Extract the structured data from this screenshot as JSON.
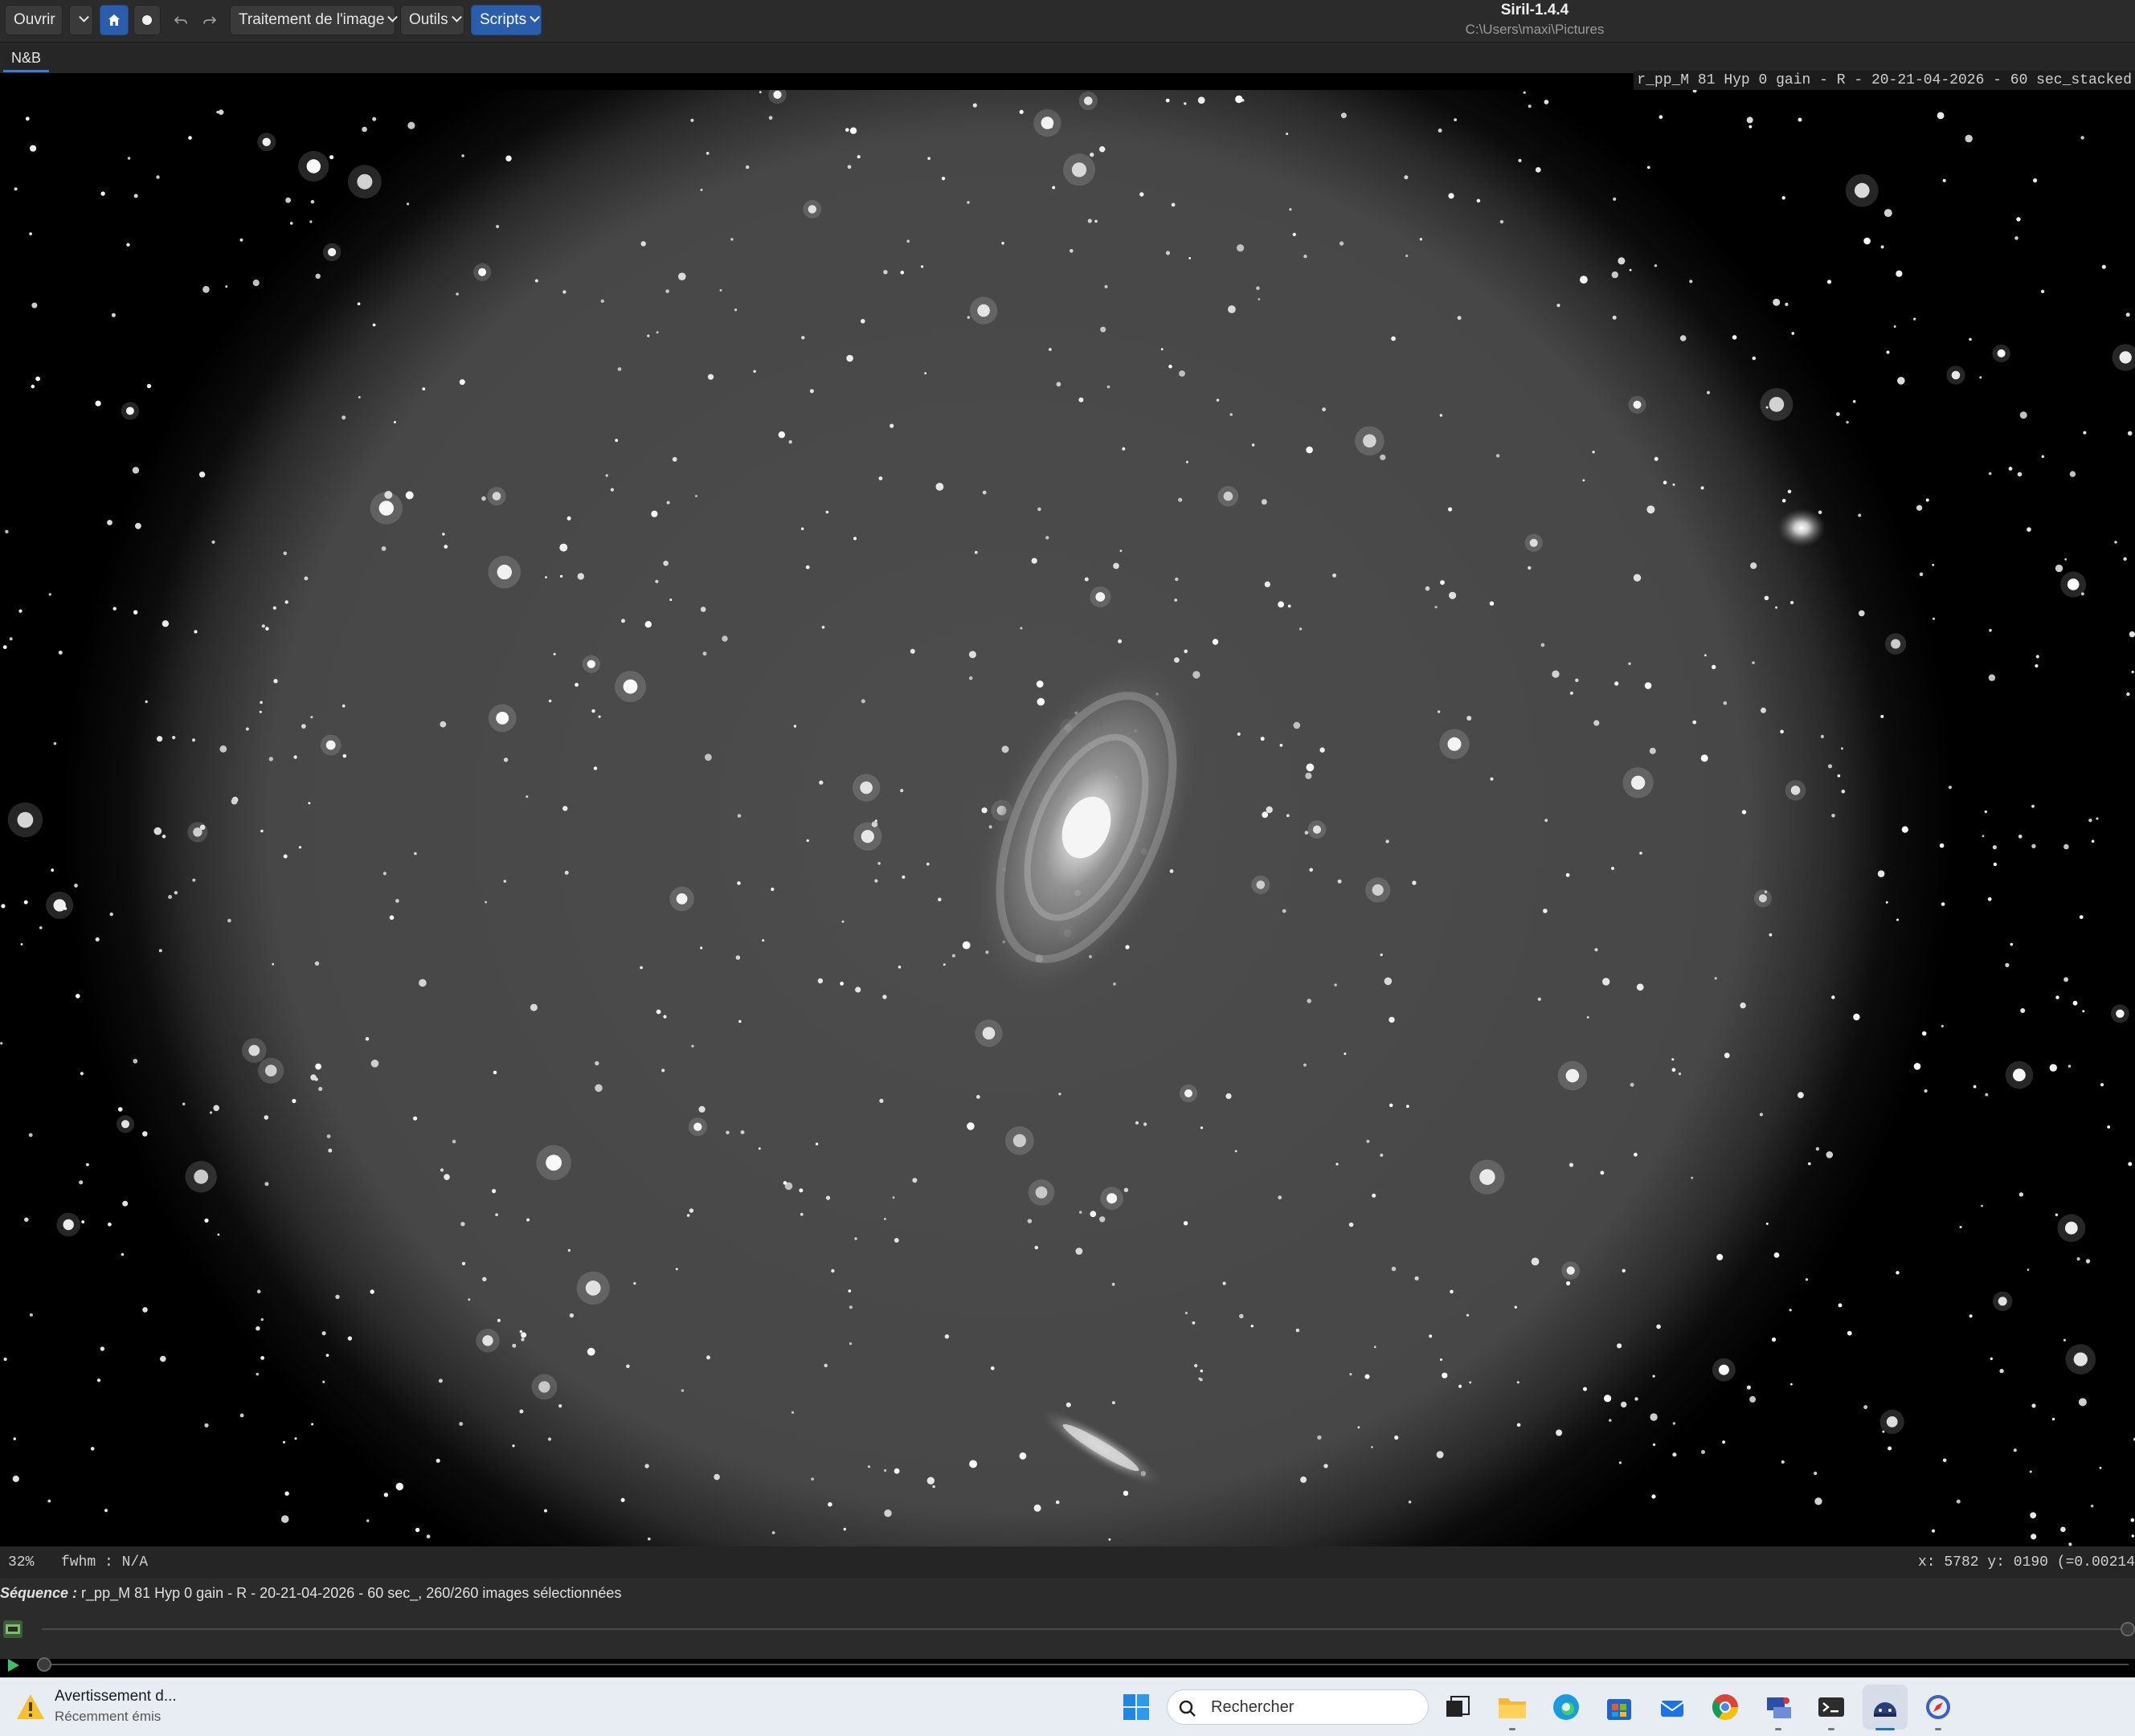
{
  "toolbar": {
    "open_label": "Ouvrir",
    "image_processing_label": "Traitement de l'image",
    "tools_label": "Outils",
    "scripts_label": "Scripts"
  },
  "window": {
    "title": "Siril-1.4.4",
    "path": "C:\\Users\\maxi\\Pictures"
  },
  "tabs": [
    {
      "label": "N&B",
      "selected": true
    }
  ],
  "image": {
    "filename": "r_pp_M 81 Hyp 0 gain - R - 20-21-04-2026 - 60 sec_stacked"
  },
  "status": {
    "zoom": "32%",
    "fwhm": "fwhm : N/A",
    "coords": "x: 5782 y: 0190 (=0.00214"
  },
  "sequence": {
    "label": "Séquence :",
    "text": "r_pp_M 81 Hyp 0 gain - R - 20-21-04-2026 - 60 sec_, 260/260 images sélectionnées"
  },
  "taskbar": {
    "notification_title": "Avertissement d...",
    "notification_subtitle": "Récemment émis",
    "search_placeholder": "Rechercher",
    "apps": [
      "windows-start",
      "task-view",
      "file-explorer",
      "edge",
      "store",
      "mail",
      "chrome",
      "network-tool",
      "terminal",
      "siril",
      "app-compass"
    ]
  },
  "colors": {
    "accent": "#2a5dab",
    "toolbar_bg": "#2b2b2b",
    "taskbar_bg": "#e8edf4"
  }
}
